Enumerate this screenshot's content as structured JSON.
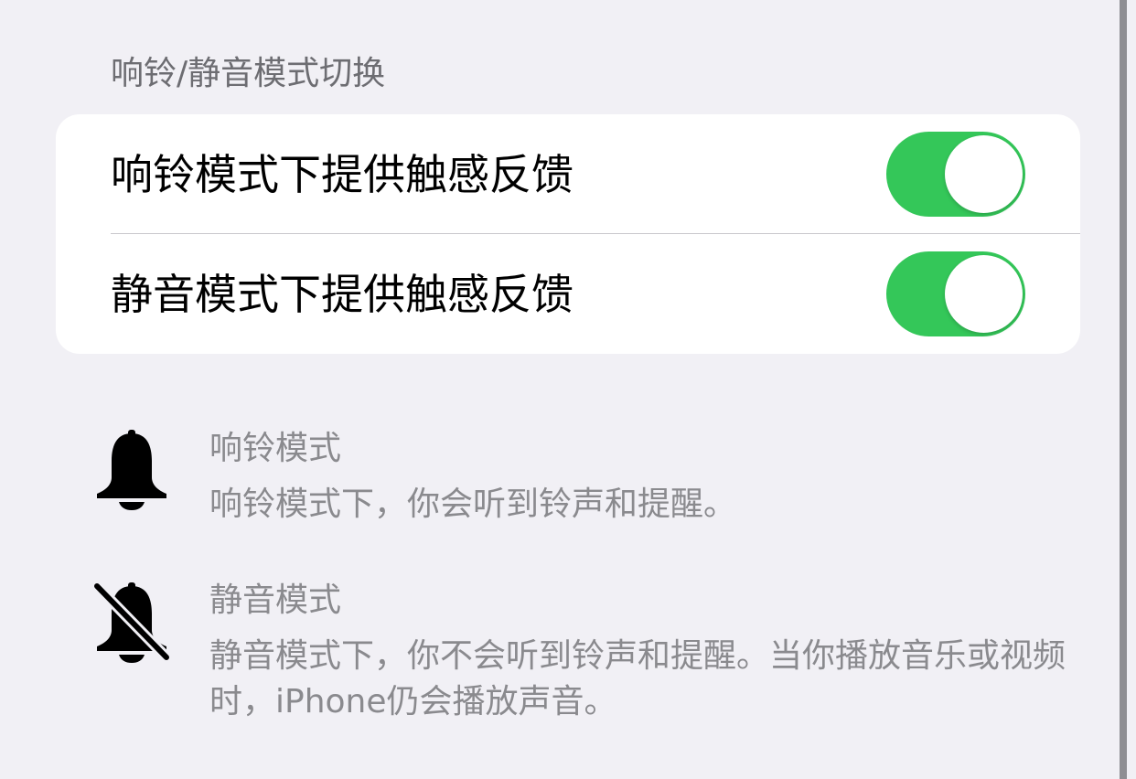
{
  "section": {
    "header": "响铃/静音模式切换"
  },
  "toggles": [
    {
      "label": "响铃模式下提供触感反馈",
      "on": true
    },
    {
      "label": "静音模式下提供触感反馈",
      "on": true
    }
  ],
  "colors": {
    "background": "#f1f0f5",
    "card": "#ffffff",
    "toggle_on": "#34c759",
    "secondary_text": "#8a8a8e",
    "header_text": "#6d6d72"
  },
  "modes": {
    "ring": {
      "icon": "bell-icon",
      "title": "响铃模式",
      "description": "响铃模式下，你会听到铃声和提醒。"
    },
    "silent": {
      "icon": "bell-slash-icon",
      "title": "静音模式",
      "description": "静音模式下，你不会听到铃声和提醒。当你播放音乐或视频时，iPhone仍会播放声音。"
    }
  }
}
